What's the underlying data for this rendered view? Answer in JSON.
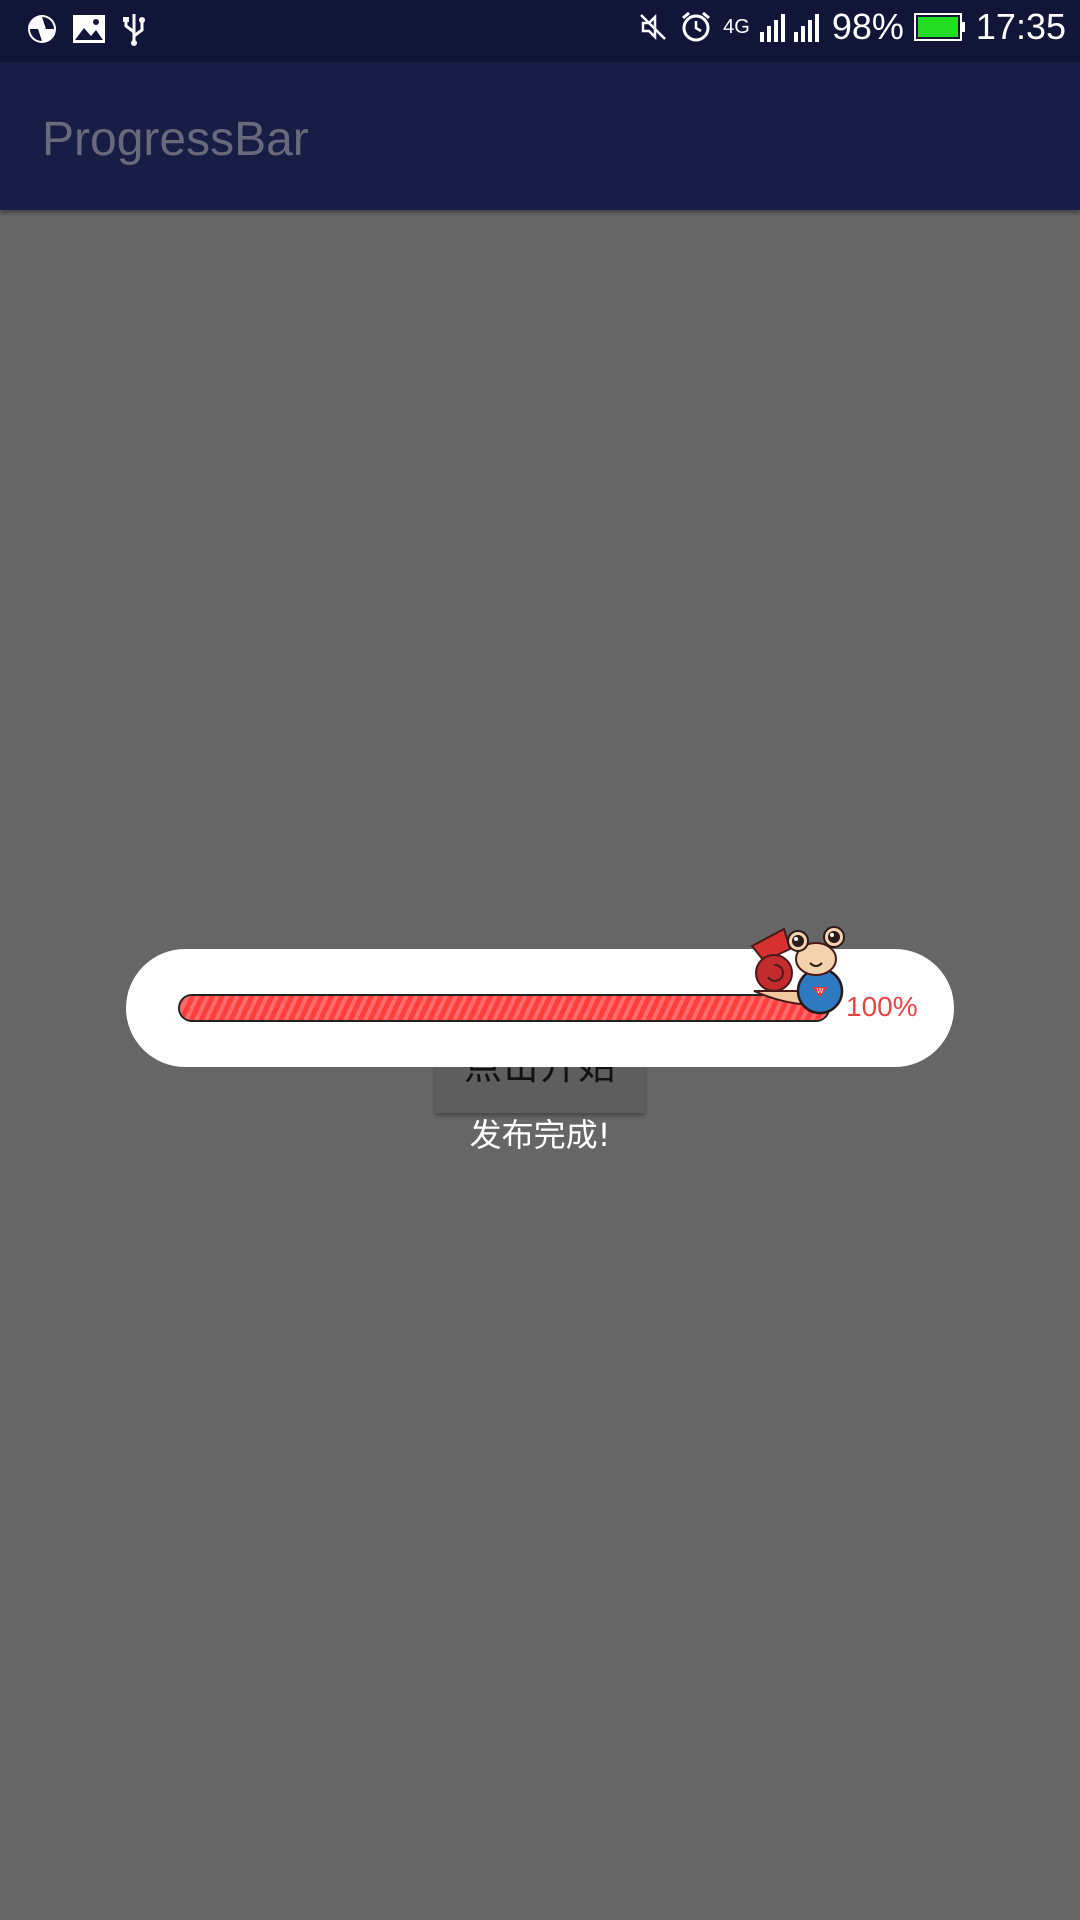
{
  "status_bar": {
    "left_icons": [
      "sync-icon",
      "image-icon",
      "usb-icon"
    ],
    "right_icons": [
      "mute-icon",
      "alarm-icon",
      "signal-icon",
      "battery-icon"
    ],
    "network": "4G",
    "battery": "98%",
    "time": "17:35"
  },
  "app_bar": {
    "title": "ProgressBar"
  },
  "main": {
    "start_button": "点击开始"
  },
  "progress_dialog": {
    "progress": 1.0,
    "percent_label": "100%",
    "colors": {
      "fill": "#ff4a4a",
      "text": "#e74545"
    }
  },
  "toast": {
    "message": "发布完成!"
  }
}
